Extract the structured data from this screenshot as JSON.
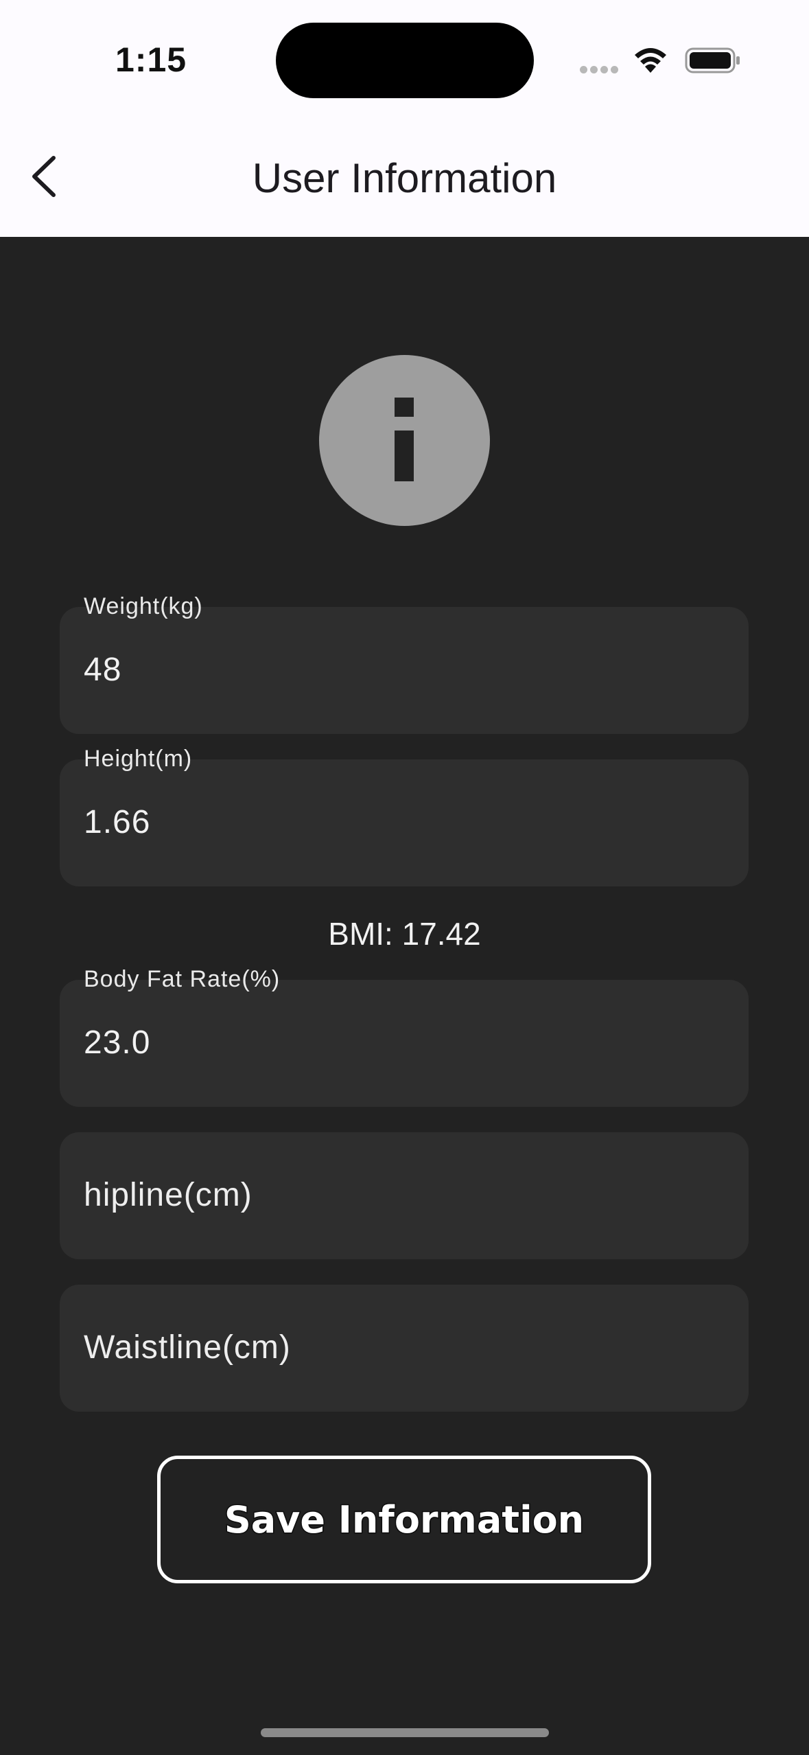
{
  "status_bar": {
    "time": "1:15"
  },
  "header": {
    "title": "User Information",
    "back_icon": "chevron-left-icon"
  },
  "hero_icon": "info-icon",
  "fields": {
    "weight": {
      "label": "Weight(kg)",
      "value": "48"
    },
    "height": {
      "label": "Height(m)",
      "value": "1.66"
    },
    "body_fat": {
      "label": "Body Fat Rate(%)",
      "value": "23.0"
    },
    "hipline": {
      "placeholder": "hipline(cm)"
    },
    "waistline": {
      "placeholder": "Waistline(cm)"
    }
  },
  "bmi_text": "BMI: 17.42",
  "save_button": {
    "label": "Save Information"
  },
  "colors": {
    "background": "#222222",
    "header_background": "#fdfbff",
    "field_background": "#2e2e2e",
    "info_circle": "#9e9e9e"
  }
}
